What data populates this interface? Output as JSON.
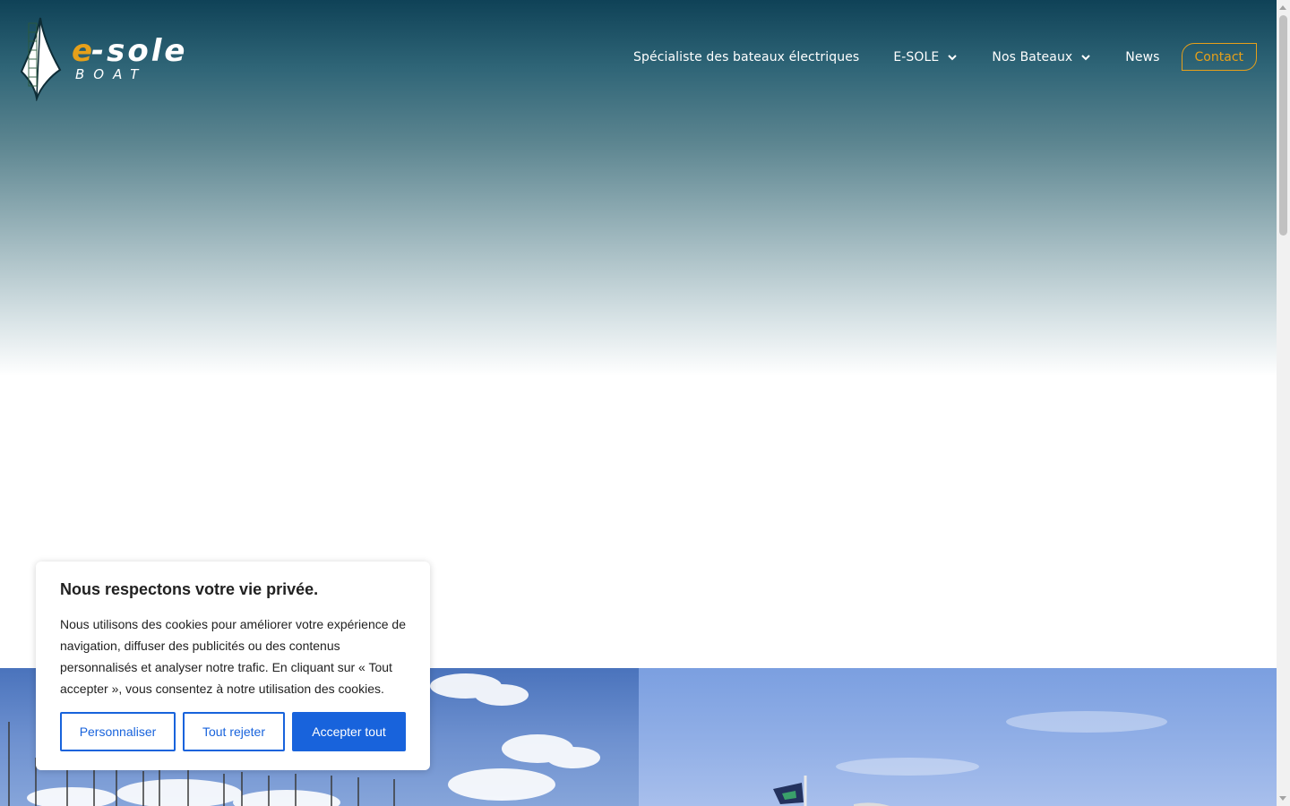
{
  "header": {
    "logo": {
      "main": "e-sole",
      "sub": "BOAT"
    },
    "nav": [
      {
        "label": "Spécialiste des bateaux électriques"
      },
      {
        "label": "E-SOLE",
        "dropdown": true
      },
      {
        "label": "Nos Bateaux",
        "dropdown": true
      },
      {
        "label": "News"
      }
    ],
    "contact_label": "Contact"
  },
  "colors": {
    "accent": "#e6a01a",
    "header_dark": "#0f4257",
    "cookie_primary": "#1863dc"
  },
  "cookie": {
    "title": "Nous respectons votre vie privée.",
    "text": "Nous utilisons des cookies pour améliorer votre expérience de navigation, diffuser des publicités ou des contenus personnalisés et analyser notre trafic. En cliquant sur « Tout accepter », vous consentez à notre utilisation des cookies.",
    "buttons": {
      "customize": "Personnaliser",
      "reject": "Tout rejeter",
      "accept": "Accepter tout"
    }
  },
  "icons": [
    "chevron-down-icon",
    "sail-logo-icon"
  ]
}
